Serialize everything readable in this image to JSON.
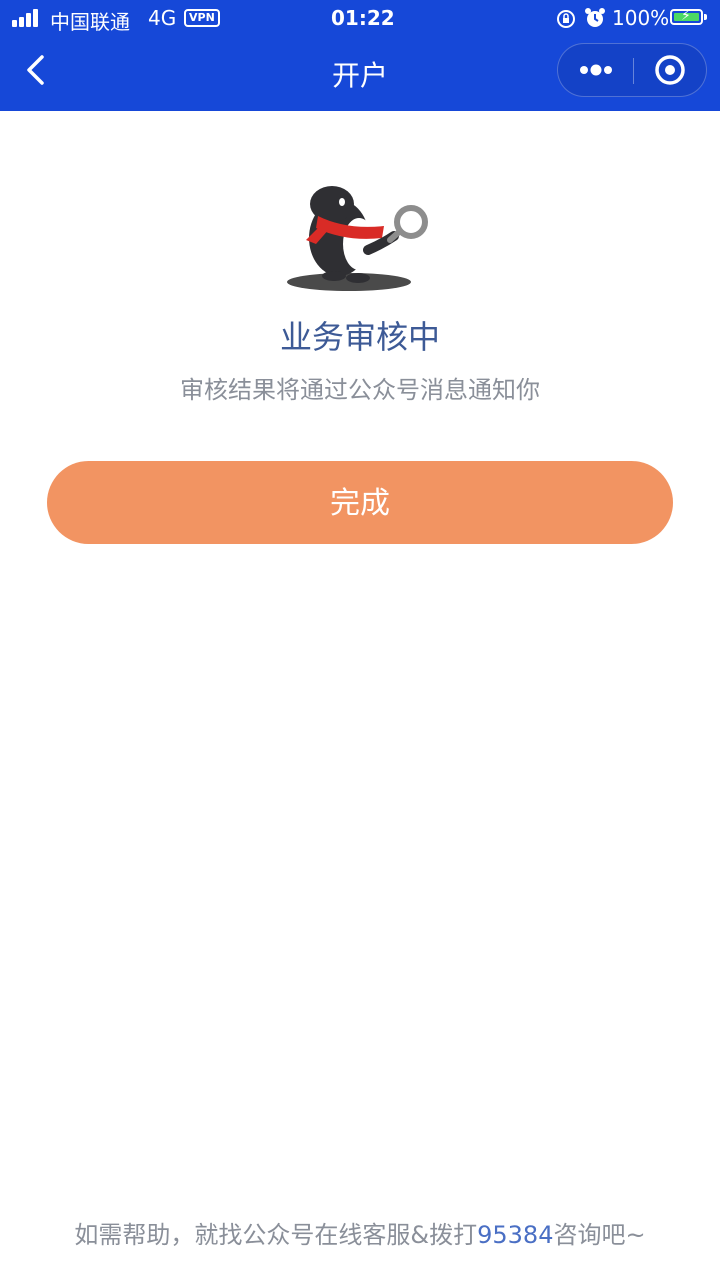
{
  "status_bar": {
    "carrier": "中国联通",
    "network": "4G",
    "vpn": "VPN",
    "time": "01:22",
    "battery_pct": "100%",
    "icons": [
      "signal-icon",
      "lock-rotation-icon",
      "alarm-icon",
      "battery-charging-icon"
    ]
  },
  "nav": {
    "title": "开户",
    "icons": [
      "back-chevron-icon",
      "more-dots-icon",
      "close-target-icon"
    ]
  },
  "result": {
    "title": "业务审核中",
    "description": "审核结果将通过公众号消息通知你"
  },
  "actions": {
    "done_label": "完成"
  },
  "footer": {
    "help_prefix": "如需帮助，就找公众号在线客服&拨打",
    "phone": "95384",
    "help_suffix": "咨询吧~"
  },
  "colors": {
    "header_bg": "#1648d8",
    "button_bg": "#f29462",
    "title_text": "#3d5a96",
    "muted_text": "#8a8f99",
    "link_text": "#4a6fc4"
  }
}
